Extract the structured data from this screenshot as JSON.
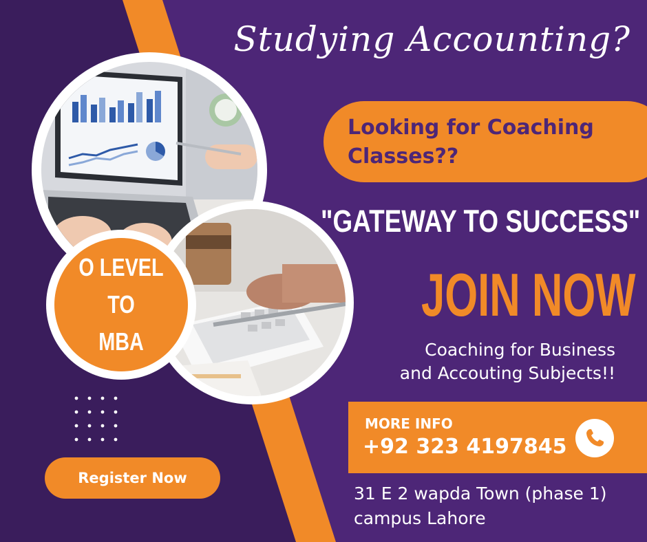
{
  "headline": "Studying Accounting?",
  "coaching_pill": {
    "line1": "Looking for Coaching",
    "line2": "Classes??"
  },
  "slogan": "\"GATEWAY TO SUCCESS\"",
  "cta": "JOIN NOW",
  "description": {
    "line1": "Coaching for Business",
    "line2": "and Accouting Subjects!!"
  },
  "badge": {
    "line1": "O LEVEL",
    "line2": "TO",
    "line3": "MBA"
  },
  "contact": {
    "label": "MORE INFO",
    "phone": "+92 323 4197845",
    "icon": "phone-icon"
  },
  "address": {
    "line1": "31 E 2 wapda Town (phase 1)",
    "line2": "campus Lahore"
  },
  "register_button": "Register Now",
  "colors": {
    "purple": "#4d2677",
    "dark_purple": "#3a1d5c",
    "orange": "#f18a28",
    "white": "#ffffff"
  }
}
